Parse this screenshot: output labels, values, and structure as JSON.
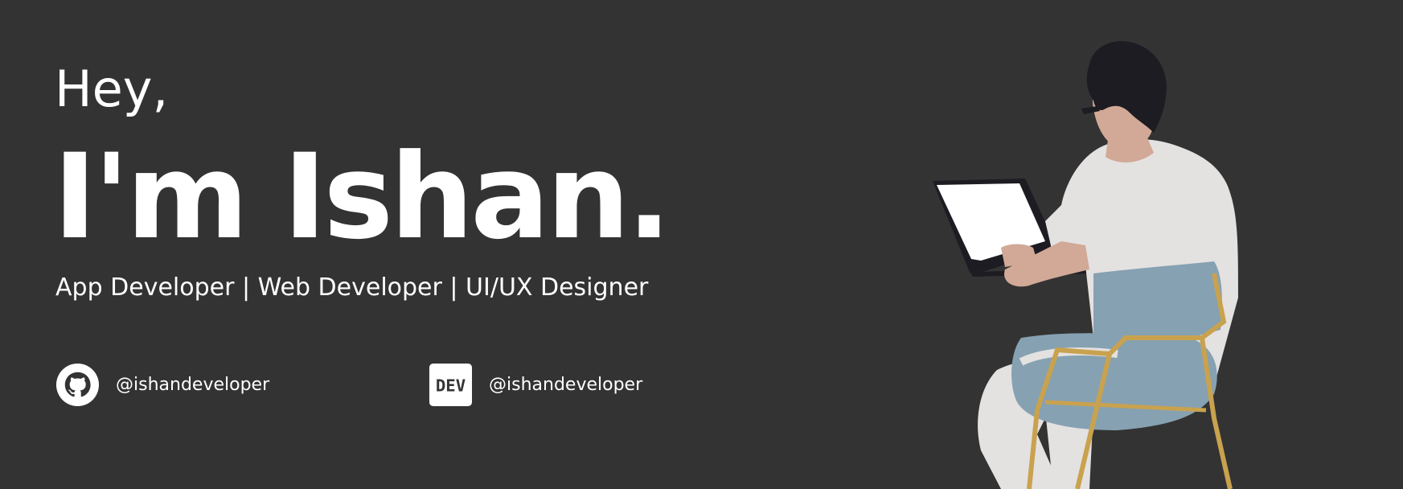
{
  "hero": {
    "greeting": "Hey,",
    "name": "I'm Ishan.",
    "roles": "App Developer | Web Developer | UI/UX Designer"
  },
  "socials": {
    "github": {
      "icon": "github-icon",
      "handle": "@ishandeveloper"
    },
    "dev": {
      "icon": "dev-icon",
      "icon_text": "DEV",
      "handle": "@ishandeveloper"
    }
  },
  "colors": {
    "background": "#333333",
    "text": "#ffffff",
    "chair_seat": "#86a1b1",
    "chair_frame": "#c9a24f",
    "shirt": "#e4e1e1",
    "skin": "#d1a996",
    "hair": "#1c1c22"
  }
}
